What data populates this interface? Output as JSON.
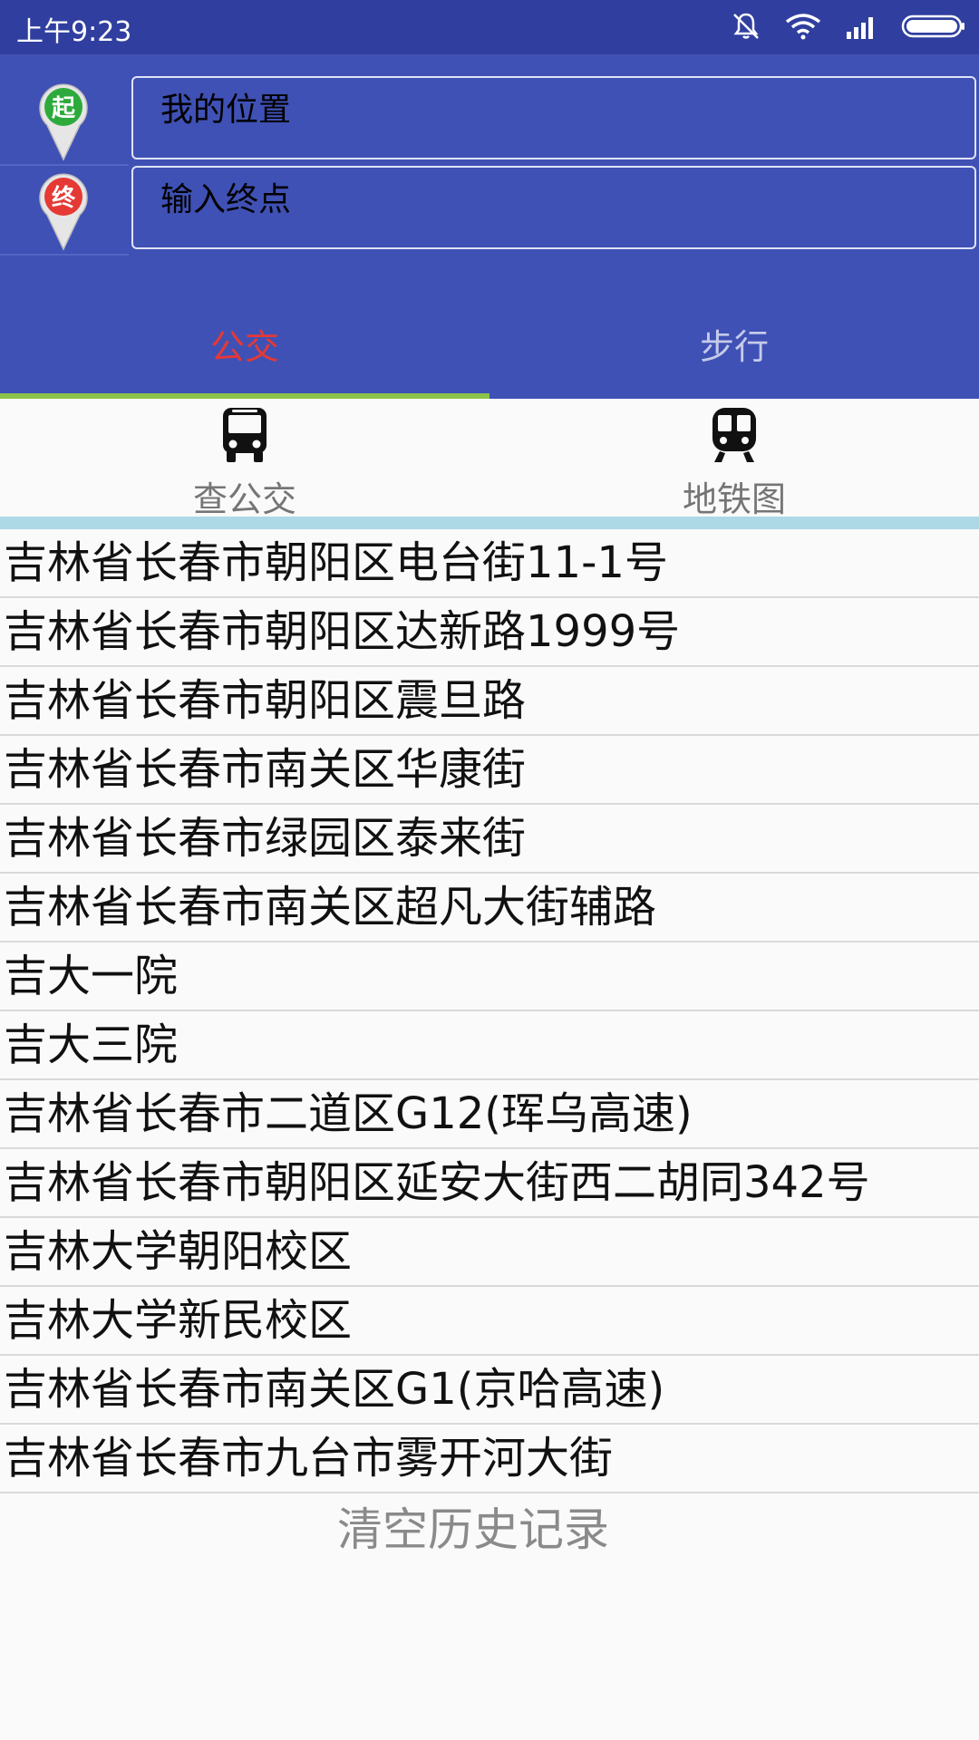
{
  "status_bar": {
    "time": "上午9:23",
    "icons": [
      "mute-icon",
      "wifi-icon",
      "signal-icon",
      "battery-icon"
    ]
  },
  "route": {
    "start_marker": "起",
    "end_marker": "终",
    "start_value": "我的位置",
    "end_placeholder": "输入终点",
    "start_color": "#2eaa3c",
    "end_color": "#e53935"
  },
  "tabs": [
    {
      "label": "公交",
      "active": true,
      "color": "#e53935"
    },
    {
      "label": "步行",
      "active": false,
      "color": "#c5cae9"
    }
  ],
  "tab_indicator_color": "#8bc34a",
  "quick_actions": [
    {
      "label": "查公交",
      "icon": "bus-icon"
    },
    {
      "label": "地铁图",
      "icon": "subway-icon"
    }
  ],
  "history": [
    "吉林省长春市朝阳区电台街11-1号",
    "吉林省长春市朝阳区达新路1999号",
    "吉林省长春市朝阳区震旦路",
    "吉林省长春市南关区华康街",
    "吉林省长春市绿园区泰来街",
    "吉林省长春市南关区超凡大街辅路",
    "吉大一院",
    "吉大三院",
    "吉林省长春市二道区G12(珲乌高速)",
    "吉林省长春市朝阳区延安大街西二胡同342号",
    "吉林大学朝阳校区",
    "吉林大学新民校区",
    "吉林省长春市南关区G1(京哈高速)",
    "吉林省长春市九台市雾开河大街"
  ],
  "clear_label": "清空历史记录"
}
